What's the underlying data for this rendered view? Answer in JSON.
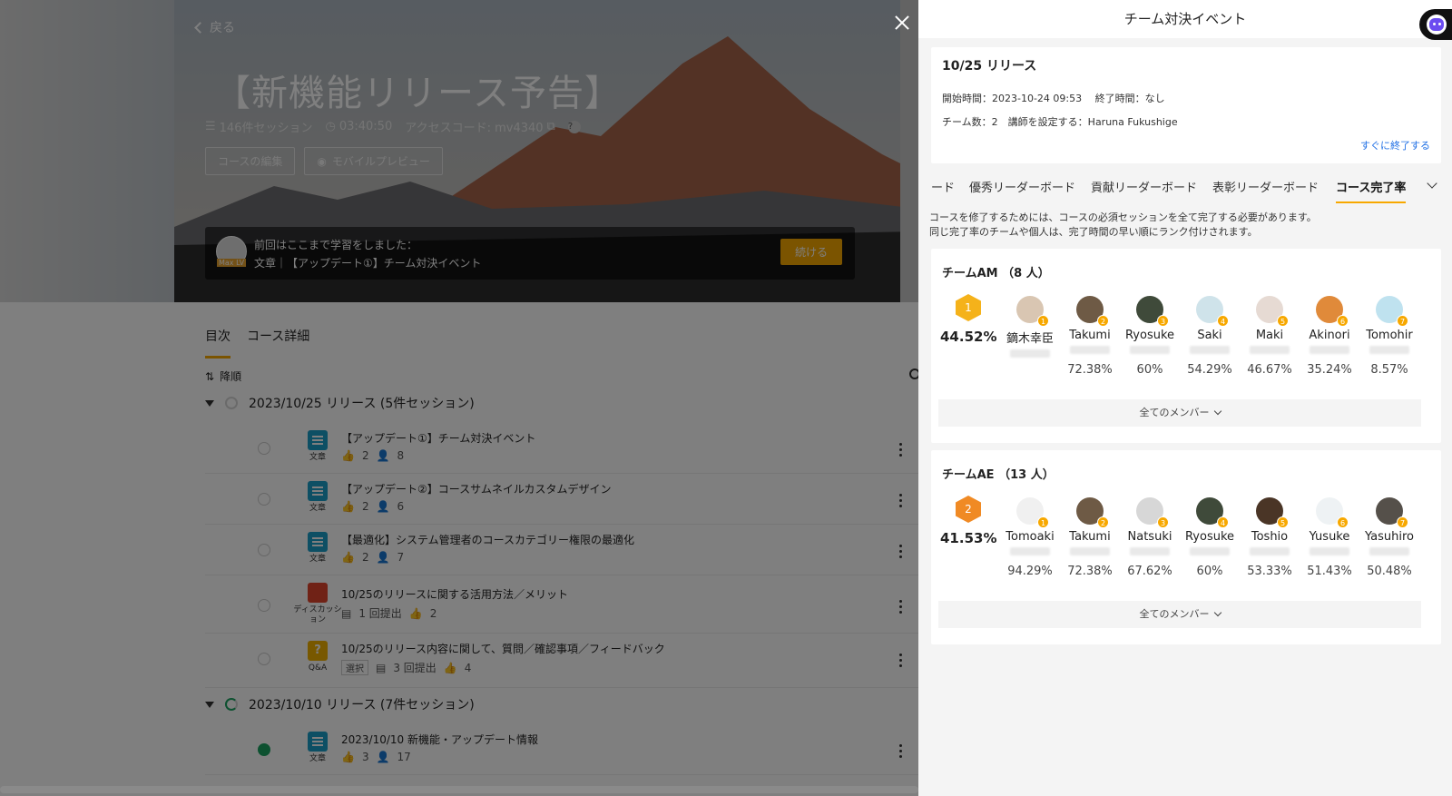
{
  "course": {
    "back": "戻る",
    "title": "【新機能リリース予告】",
    "sessions": "146件セッション",
    "duration": "03:40:50",
    "access_code": "アクセスコード: mv4340",
    "edit_btn": "コースの編集",
    "preview_btn": "モバイルプレビュー",
    "resume_line1": "前回はここまで学習をしました：",
    "resume_line2": "文章｜【アップデート①】チーム対決イベント",
    "resume_tag": "Max LV",
    "continue_btn": "続ける",
    "tabs": [
      "目次",
      "コース詳細"
    ],
    "sort": "降順",
    "sections": [
      {
        "title": "2023/10/25 リリース (5件セッション)"
      },
      {
        "title": "2023/10/10 リリース (7件セッション)"
      }
    ],
    "rows": [
      {
        "type": "文章",
        "title": "【アップデート①】チーム対決イベント",
        "likes": "2",
        "users": "8"
      },
      {
        "type": "文章",
        "title": "【アップデート②】コースサムネイルカスタムデザイン",
        "likes": "2",
        "users": "6"
      },
      {
        "type": "文章",
        "title": "【最適化】システム管理者のコースカテゴリー権限の最適化",
        "likes": "2",
        "users": "7"
      },
      {
        "type": "ディスカッション",
        "title": "10/25のリリースに関する活用方法／メリット",
        "subs": "1 回提出",
        "likes": "2"
      },
      {
        "type": "Q&A",
        "title": "10/25のリリース内容に関して、質問／確認事項／フィードバック",
        "tag": "選択",
        "subs": "3 回提出",
        "likes": "4"
      },
      {
        "type": "文章",
        "title": "2023/10/10 新機能・アップデート情報",
        "likes": "3",
        "users": "17"
      }
    ]
  },
  "panel": {
    "title": "チーム対決イベント",
    "event_name": "10/25 リリース",
    "times": "開始時間：2023-10-24 09:53　 終了時間：なし",
    "teams_info": "チーム数：2　講師を設定する：Haruna Fukushige",
    "end_now": "すぐに終了する",
    "tabs": [
      "ード",
      "優秀リーダーボード",
      "貢献リーダーボード",
      "表彰リーダーボード",
      "コース完了率"
    ],
    "desc1": "コースを修了するためには、コースの必須セッションを全て完了する必要があります。",
    "desc2": "同じ完了率のチームや個人は、完了時間の早い順にランク付けされます。",
    "all_members": "全てのメンバー",
    "teams": [
      {
        "name": "チームAM （8 人）",
        "rank": "1",
        "percent": "44.52%",
        "members": [
          {
            "name": "鏑木幸臣",
            "rank": "1",
            "pct": ""
          },
          {
            "name": "Takumi",
            "rank": "2",
            "pct": "72.38%"
          },
          {
            "name": "Ryosuke",
            "rank": "3",
            "pct": "60%"
          },
          {
            "name": "Saki",
            "rank": "4",
            "pct": "54.29%"
          },
          {
            "name": "Maki",
            "rank": "5",
            "pct": "46.67%"
          },
          {
            "name": "Akinori",
            "rank": "6",
            "pct": "35.24%"
          },
          {
            "name": "Tomohir",
            "rank": "7",
            "pct": "8.57%"
          }
        ]
      },
      {
        "name": "チームAE （13 人）",
        "rank": "2",
        "percent": "41.53%",
        "members": [
          {
            "name": "Tomoaki",
            "rank": "1",
            "pct": "94.29%"
          },
          {
            "name": "Takumi",
            "rank": "2",
            "pct": "72.38%"
          },
          {
            "name": "Natsuki",
            "rank": "3",
            "pct": "67.62%"
          },
          {
            "name": "Ryosuke",
            "rank": "4",
            "pct": "60%"
          },
          {
            "name": "Toshio",
            "rank": "5",
            "pct": "53.33%"
          },
          {
            "name": "Yusuke",
            "rank": "6",
            "pct": "51.43%"
          },
          {
            "name": "Yasuhiro",
            "rank": "7",
            "pct": "50.48%"
          }
        ]
      }
    ]
  },
  "colors": {
    "accent": "#f7a800",
    "link": "#1f6fe5",
    "doc": "#1a9ec9",
    "discussion": "#e0442c",
    "qa": "#f0b000",
    "done": "#1aa260"
  }
}
